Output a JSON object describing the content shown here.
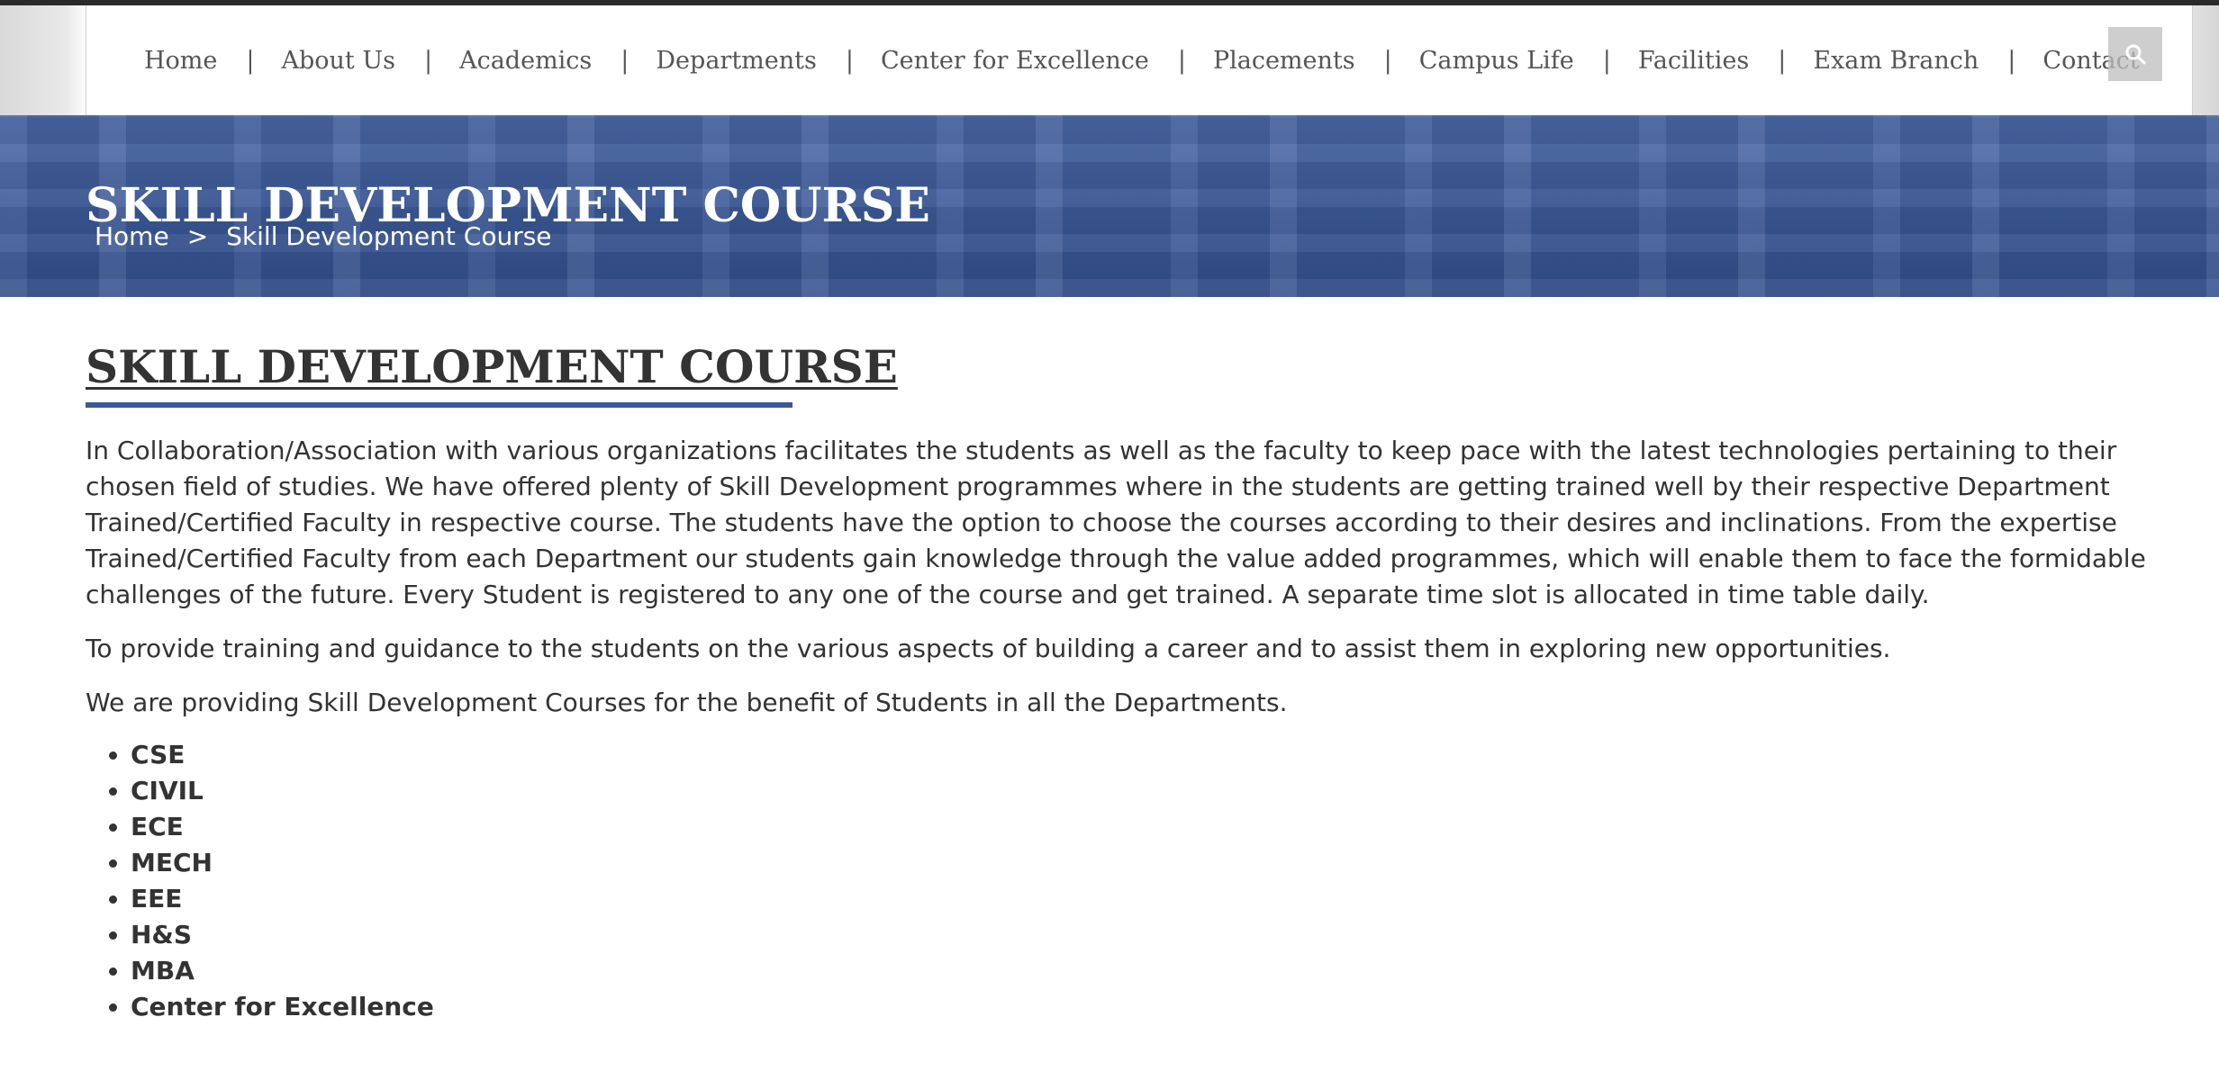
{
  "nav": {
    "items": [
      "Home",
      "About Us",
      "Academics",
      "Departments",
      "Center for Excellence",
      "Placements",
      "Campus Life",
      "Facilities",
      "Exam Branch",
      "Contact"
    ],
    "separator": "|",
    "search_icon": "search-icon"
  },
  "banner": {
    "title": "SKILL DEVELOPMENT COURSE",
    "breadcrumb": {
      "home": "Home",
      "separator": ">",
      "current": "Skill Development Course"
    }
  },
  "main": {
    "title": "SKILL DEVELOPMENT COURSE",
    "paragraphs": [
      "In Collaboration/Association with various organizations facilitates the students as well as the faculty to keep pace with the latest technologies pertaining to their chosen field of studies. We have offered plenty of Skill Development programmes where in the students are getting trained well by their respective Department Trained/Certified Faculty in respective course. The students have the option to choose the courses according to their desires and inclinations. From the expertise Trained/Certified Faculty from each Department our students gain knowledge through the value added programmes, which will enable them to face the formidable challenges of the future. Every Student is registered to any one of the course and get trained. A separate time slot is allocated in time table daily.",
      "To provide training and guidance to the students on the various aspects of building a career and to assist them in exploring new opportunities.",
      "We are providing Skill Development Courses for the benefit of Students in all the Departments."
    ],
    "departments": [
      "CSE",
      "CIVIL",
      "ECE",
      "MECH",
      "EEE",
      "H&S",
      "MBA",
      "Center for Excellence"
    ]
  },
  "colors": {
    "accent": "#3b5998",
    "text": "#333333",
    "nav_text": "#555555"
  }
}
